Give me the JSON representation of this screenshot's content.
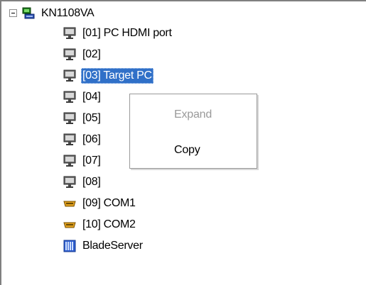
{
  "tree": {
    "root": {
      "label": "KN1108VA",
      "icon": "network-device-icon"
    },
    "ports": [
      {
        "label": "[01] PC HDMI port",
        "icon": "monitor-icon",
        "selected": false
      },
      {
        "label": "[02]",
        "icon": "monitor-icon",
        "selected": false
      },
      {
        "label": "[03] Target PC",
        "icon": "monitor-icon",
        "selected": true
      },
      {
        "label": "[04]",
        "icon": "monitor-icon",
        "selected": false
      },
      {
        "label": "[05]",
        "icon": "monitor-icon",
        "selected": false
      },
      {
        "label": "[06]",
        "icon": "monitor-icon",
        "selected": false
      },
      {
        "label": "[07]",
        "icon": "monitor-icon",
        "selected": false
      },
      {
        "label": "[08]",
        "icon": "monitor-icon",
        "selected": false
      },
      {
        "label": "[09] COM1",
        "icon": "serial-port-icon",
        "selected": false
      },
      {
        "label": "[10] COM2",
        "icon": "serial-port-icon",
        "selected": false
      },
      {
        "label": "BladeServer",
        "icon": "blade-server-icon",
        "selected": false
      }
    ]
  },
  "context_menu": {
    "items": [
      {
        "label": "Expand",
        "enabled": false
      },
      {
        "label": "Copy",
        "enabled": true
      }
    ]
  },
  "colors": {
    "selection": "#3070c8",
    "disabled_text": "#9a9a9a"
  }
}
